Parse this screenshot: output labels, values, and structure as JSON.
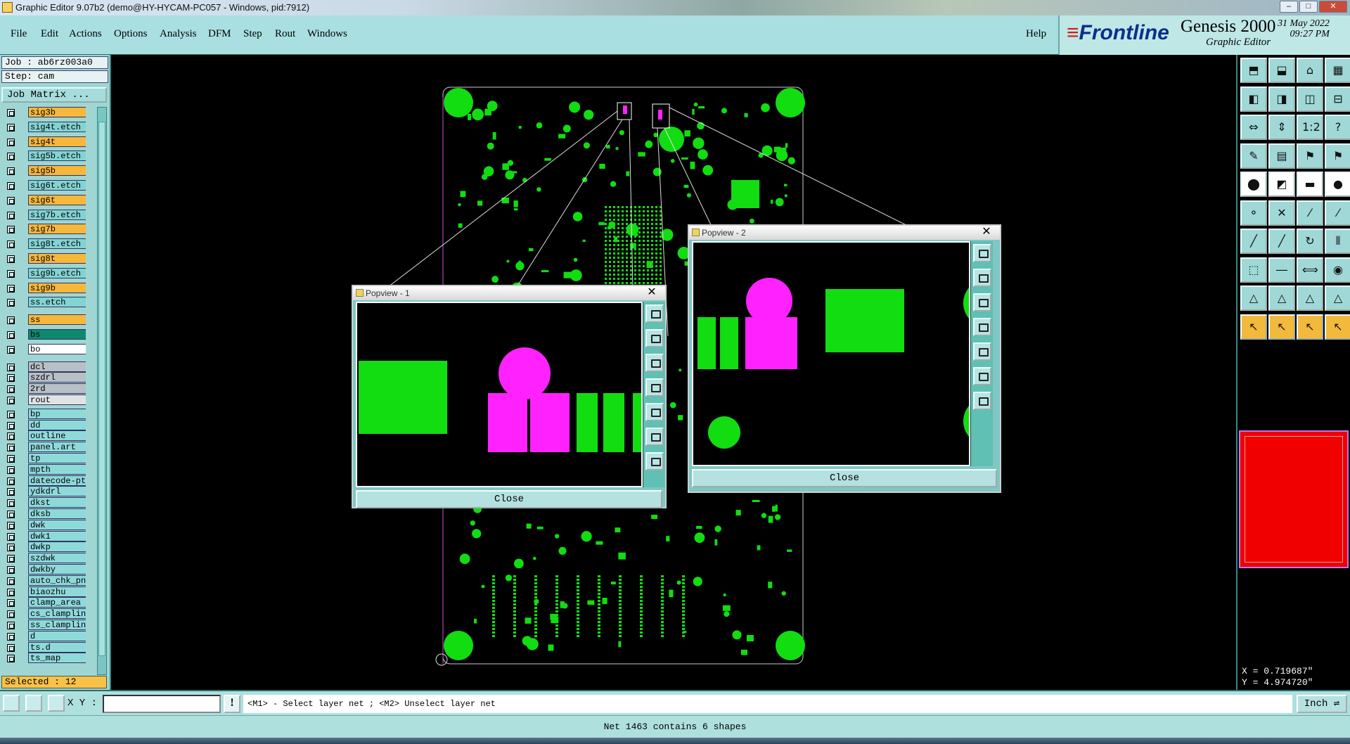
{
  "window": {
    "title": "Graphic Editor 9.07b2 (demo@HY-HYCAM-PC057 - Windows, pid:7912)"
  },
  "menu": [
    {
      "label": "File"
    },
    {
      "label": "Edit"
    },
    {
      "label": "Actions"
    },
    {
      "label": "Options"
    },
    {
      "label": "Analysis"
    },
    {
      "label": "DFM"
    },
    {
      "label": "Step"
    },
    {
      "label": "Rout"
    },
    {
      "label": "Windows"
    }
  ],
  "help_label": "Help",
  "brand": {
    "logo": "Frontline",
    "product": "Genesis 2000",
    "subtitle": "Graphic Editor",
    "date": "31 May 2022",
    "time": "09:27 PM"
  },
  "job": {
    "job_label": "Job : ab6rz003a0",
    "step_label": "Step: cam",
    "matrix_button": "Job Matrix ..."
  },
  "layers": [
    {
      "name": "sig3b",
      "color": "#f7b73a"
    },
    {
      "name": "sig4t.etch",
      "color": "#82d4d2"
    },
    {
      "name": "sig4t",
      "color": "#f7b73a"
    },
    {
      "name": "sig5b.etch",
      "color": "#82d4d2"
    },
    {
      "name": "sig5b",
      "color": "#f7b73a"
    },
    {
      "name": "sig6t.etch",
      "color": "#82d4d2"
    },
    {
      "name": "sig6t",
      "color": "#f7b73a"
    },
    {
      "name": "sig7b.etch",
      "color": "#82d4d2"
    },
    {
      "name": "sig7b",
      "color": "#f7b73a"
    },
    {
      "name": "sig8t.etch",
      "color": "#82d4d2"
    },
    {
      "name": "sig8t",
      "color": "#f7b73a"
    },
    {
      "name": "sig9b.etch",
      "color": "#82d4d2"
    },
    {
      "name": "sig9b",
      "color": "#f7b73a"
    },
    {
      "name": "ss.etch",
      "color": "#82d4d2"
    },
    {
      "name": "ss",
      "color": "#f7b73a"
    },
    {
      "name": "bs",
      "color": "#0d8a6e"
    },
    {
      "name": "bo",
      "color": "#ffffff"
    },
    {
      "name": "dcl",
      "color": "#b7c0c4"
    },
    {
      "name": "szdrl",
      "color": "#b7c0c4"
    },
    {
      "name": "2rd",
      "color": "#b7c0c4"
    },
    {
      "name": "rout",
      "color": "#e2e2e2"
    },
    {
      "name": "bp",
      "color": "#8edad9"
    },
    {
      "name": "dd",
      "color": "#8edad9"
    },
    {
      "name": "outline",
      "color": "#8edad9"
    },
    {
      "name": "panel.art",
      "color": "#8edad9"
    },
    {
      "name": "tp",
      "color": "#8edad9"
    },
    {
      "name": "mpth",
      "color": "#8edad9"
    },
    {
      "name": "datecode-pt",
      "color": "#8edad9"
    },
    {
      "name": "ydkdrl",
      "color": "#8edad9"
    },
    {
      "name": "dkst",
      "color": "#8edad9"
    },
    {
      "name": "dksb",
      "color": "#8edad9"
    },
    {
      "name": "dwk",
      "color": "#8edad9"
    },
    {
      "name": "dwk1",
      "color": "#8edad9"
    },
    {
      "name": "dwkp",
      "color": "#8edad9"
    },
    {
      "name": "szdwk",
      "color": "#8edad9"
    },
    {
      "name": "dwkby",
      "color": "#8edad9"
    },
    {
      "name": "auto_chk_pn",
      "color": "#8edad9"
    },
    {
      "name": "biaozhu",
      "color": "#8edad9"
    },
    {
      "name": "clamp_area",
      "color": "#8edad9"
    },
    {
      "name": "cs_clampline",
      "color": "#8edad9"
    },
    {
      "name": "ss_clampline",
      "color": "#8edad9"
    },
    {
      "name": "d",
      "color": "#8edad9"
    },
    {
      "name": "ts.d",
      "color": "#8edad9"
    },
    {
      "name": "ts_map",
      "color": "#8edad9"
    }
  ],
  "selected_label": "Selected : 12",
  "popview1": {
    "title": "Popview - 1",
    "close_label": "Close"
  },
  "popview2": {
    "title": "Popview - 2",
    "close_label": "Close"
  },
  "coords": {
    "x": "X = 0.719687\"",
    "y": "Y = 4.974720\""
  },
  "command": {
    "xy_label": "X Y :",
    "xy_value": "",
    "prompt": "<M1> - Select layer net ; <M2> Unselect layer net",
    "unit": "Inch"
  },
  "status": "Net 1463 contains 6 shapes",
  "colors": {
    "copper": "#11dd11",
    "highlight": "#ff22ff",
    "panel": "#9fd6d3",
    "menu": "#a9dfe0"
  }
}
